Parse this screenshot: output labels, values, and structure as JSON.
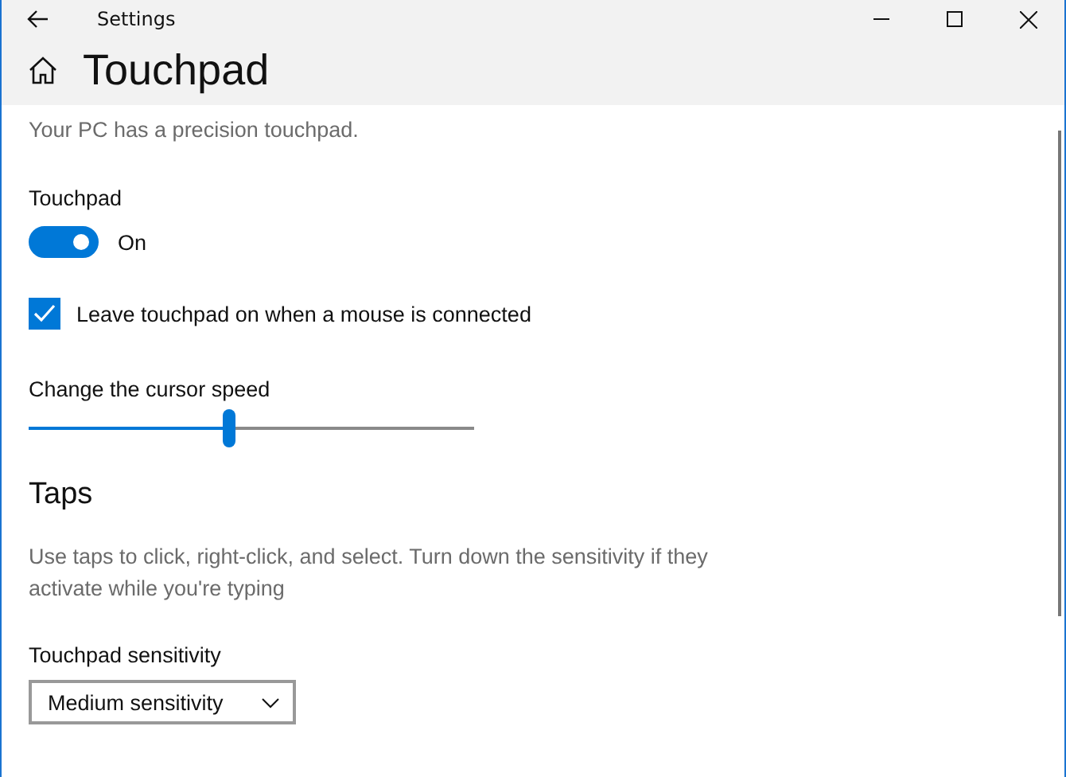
{
  "window": {
    "title": "Settings"
  },
  "page": {
    "title": "Touchpad"
  },
  "description": "Your PC has a precision touchpad.",
  "touchpad_toggle": {
    "label": "Touchpad",
    "on": true,
    "state_text": "On"
  },
  "leave_on_checkbox": {
    "label": "Leave touchpad on when a mouse is connected",
    "checked": true
  },
  "cursor_speed": {
    "label": "Change the cursor speed",
    "level": 0.45
  },
  "taps": {
    "heading": "Taps",
    "description": "Use taps to click, right-click, and select. Turn down the sensitivity if they activate while you're typing",
    "sensitivity_label": "Touchpad sensitivity",
    "sensitivity_value": "Medium sensitivity"
  }
}
